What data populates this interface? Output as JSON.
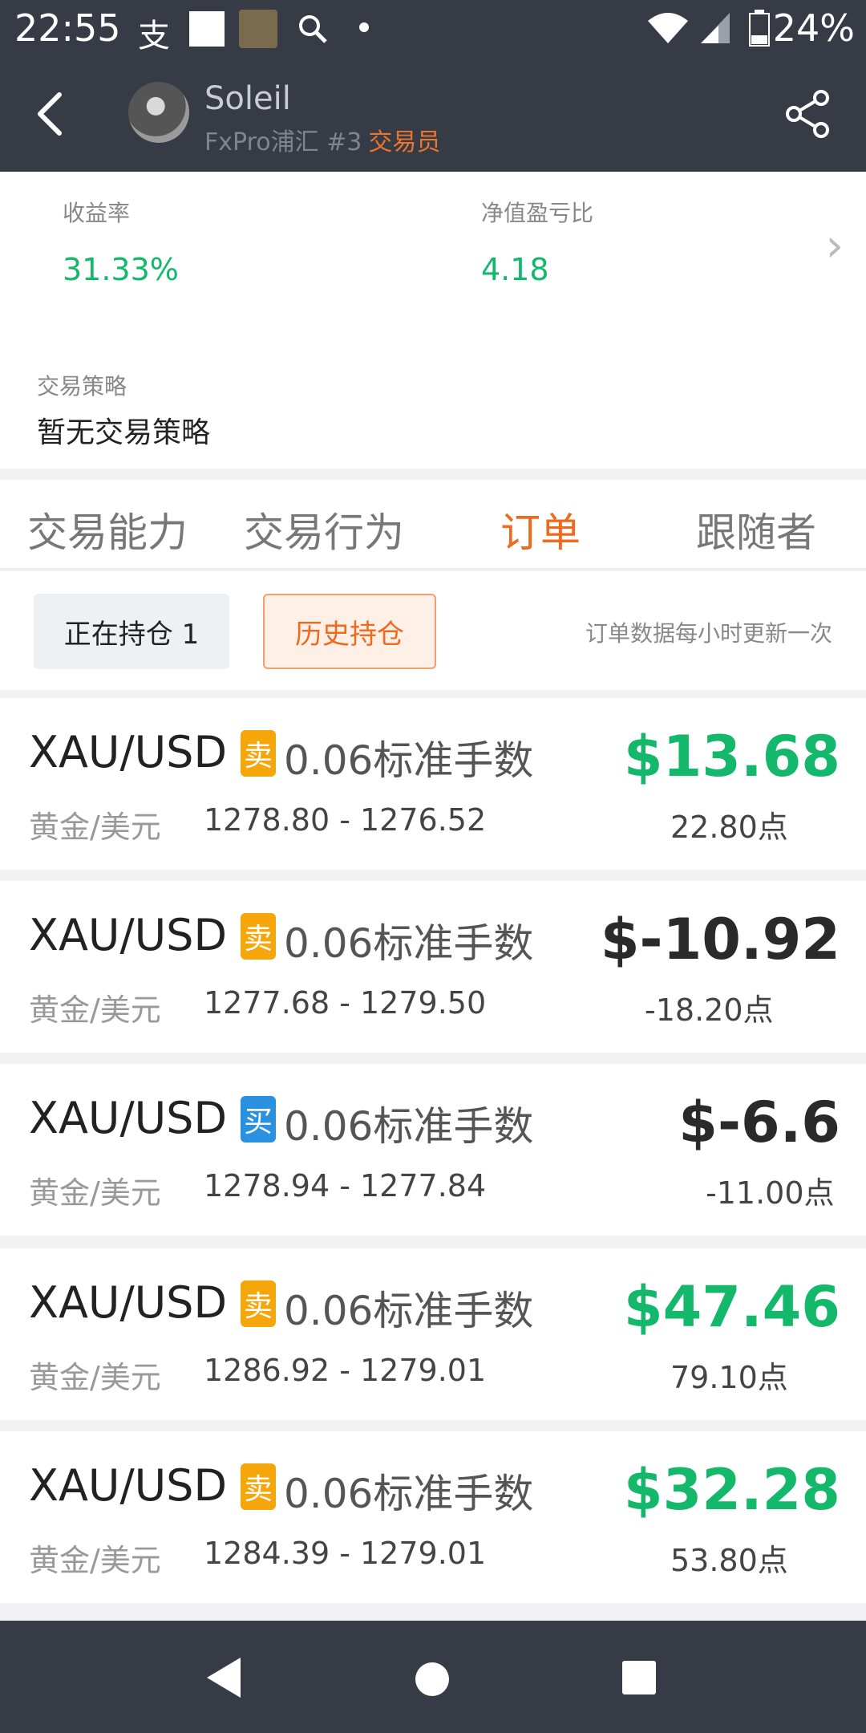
{
  "status_bar": {
    "time": "22:55",
    "battery": "24%",
    "icons": [
      "alipay-icon",
      "square-icon",
      "game-icon",
      "search-icon",
      "dot-icon",
      "wifi-icon",
      "signal-icon",
      "battery-icon"
    ]
  },
  "header": {
    "name": "Soleil",
    "broker": "FxPro浦汇 #3",
    "role": "交易员"
  },
  "stats": {
    "return_label": "收益率",
    "return_value": "31.33%",
    "ratio_label": "净值盈亏比",
    "ratio_value": "4.18",
    "strategy_label": "交易策略",
    "strategy_text": "暂无交易策略"
  },
  "tabs": [
    {
      "label": "交易能力"
    },
    {
      "label": "交易行为"
    },
    {
      "label": "订单"
    },
    {
      "label": "跟随者"
    }
  ],
  "filters": {
    "open_label": "正在持仓 1",
    "history_label": "历史持仓",
    "note": "订单数据每小时更新一次"
  },
  "orders": [
    {
      "symbol": "XAU/USD",
      "side": "卖",
      "lots": "0.06标准手数",
      "pair": "黄金/美元",
      "range": "1278.80 - 1276.52",
      "profit": "$13.68",
      "points": "22.80点"
    },
    {
      "symbol": "XAU/USD",
      "side": "卖",
      "lots": "0.06标准手数",
      "pair": "黄金/美元",
      "range": "1277.68 - 1279.50",
      "profit": "$-10.92",
      "points": "-18.20点"
    },
    {
      "symbol": "XAU/USD",
      "side": "买",
      "lots": "0.06标准手数",
      "pair": "黄金/美元",
      "range": "1278.94 - 1277.84",
      "profit": "$-6.6",
      "points": "-11.00点"
    },
    {
      "symbol": "XAU/USD",
      "side": "卖",
      "lots": "0.06标准手数",
      "pair": "黄金/美元",
      "range": "1286.92 - 1279.01",
      "profit": "$47.46",
      "points": "79.10点"
    },
    {
      "symbol": "XAU/USD",
      "side": "卖",
      "lots": "0.06标准手数",
      "pair": "黄金/美元",
      "range": "1284.39 - 1279.01",
      "profit": "$32.28",
      "points": "53.80点"
    }
  ],
  "colors": {
    "positive": "#14b86a",
    "negative": "#2a2a2a",
    "accent": "#f06a1e",
    "sell_badge": "#f4a60a",
    "buy_badge": "#2a91e0",
    "header_bg": "#363b46"
  }
}
